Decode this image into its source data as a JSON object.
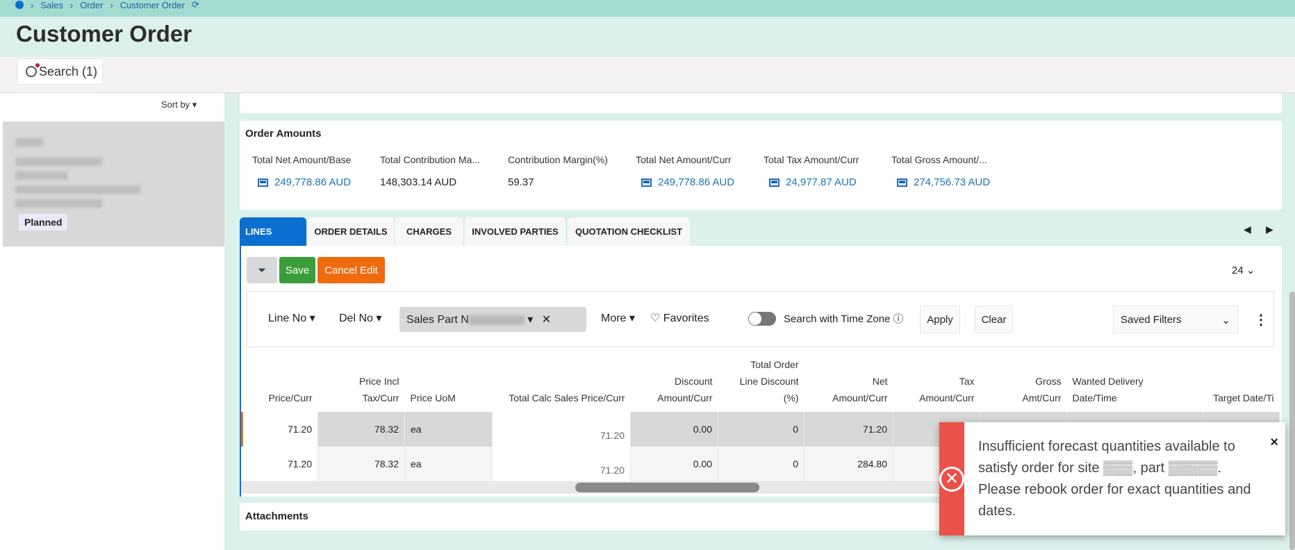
{
  "breadcrumb": [
    "Sales",
    "Order",
    "Customer Order"
  ],
  "page_title": "Customer Order",
  "search_button": "Search (1)",
  "sort_by": "Sort by",
  "record_status": "Planned",
  "order_amounts": {
    "title": "Order Amounts",
    "fields": [
      {
        "label": "Total Net Amount/Base",
        "value": "249,778.86 AUD",
        "link": true
      },
      {
        "label": "Total Contribution Ma...",
        "value": "148,303.14 AUD",
        "link": false
      },
      {
        "label": "Contribution Margin(%)",
        "value": "59.37",
        "link": false
      },
      {
        "label": "Total Net Amount/Curr",
        "value": "249,778.86 AUD",
        "link": true
      },
      {
        "label": "Total Tax Amount/Curr",
        "value": "24,977.87 AUD",
        "link": true
      },
      {
        "label": "Total Gross Amount/...",
        "value": "274,756.73 AUD",
        "link": true
      }
    ]
  },
  "tabs": [
    "LINES",
    "ORDER DETAILS",
    "CHARGES",
    "INVOLVED PARTIES",
    "QUOTATION CHECKLIST"
  ],
  "toolbar": {
    "save": "Save",
    "cancel": "Cancel Edit",
    "page_size": "24"
  },
  "filters": {
    "line_no": "Line No",
    "del_no": "Del No",
    "sales_part": "Sales Part N",
    "more": "More",
    "favorites": "Favorites",
    "time_zone": "Search with Time Zone",
    "apply": "Apply",
    "clear": "Clear",
    "saved": "Saved Filters"
  },
  "table": {
    "headers": [
      [
        "Price/Curr"
      ],
      [
        "Price Incl",
        "Tax/Curr"
      ],
      [
        "Price UoM"
      ],
      [
        "Total Calc Sales Price/Curr"
      ],
      [
        "Discount",
        "Amount/Curr"
      ],
      [
        "Total Order",
        "Line Discount",
        "(%)"
      ],
      [
        "Net",
        "Amount/Curr"
      ],
      [
        "Tax",
        "Amount/Curr"
      ],
      [
        "Gross",
        "Amt/Curr"
      ],
      [
        "Wanted Delivery",
        "Date/Time"
      ],
      [
        "Target Date/Ti"
      ]
    ],
    "rows": [
      [
        "71.20",
        "78.32",
        "ea",
        "71.20",
        "0.00",
        "0",
        "71.20",
        "",
        "",
        "",
        ""
      ],
      [
        "71.20",
        "78.32",
        "ea",
        "71.20",
        "0.00",
        "0",
        "284.80",
        "",
        "",
        "",
        ""
      ]
    ]
  },
  "attachments": "Attachments",
  "toast": {
    "message": "Insufficient forecast quantities available to satisfy order for site ▒▒▒, part ▒▒▒▒▒. Please rebook order for exact quantities and dates.",
    "close": "×"
  }
}
